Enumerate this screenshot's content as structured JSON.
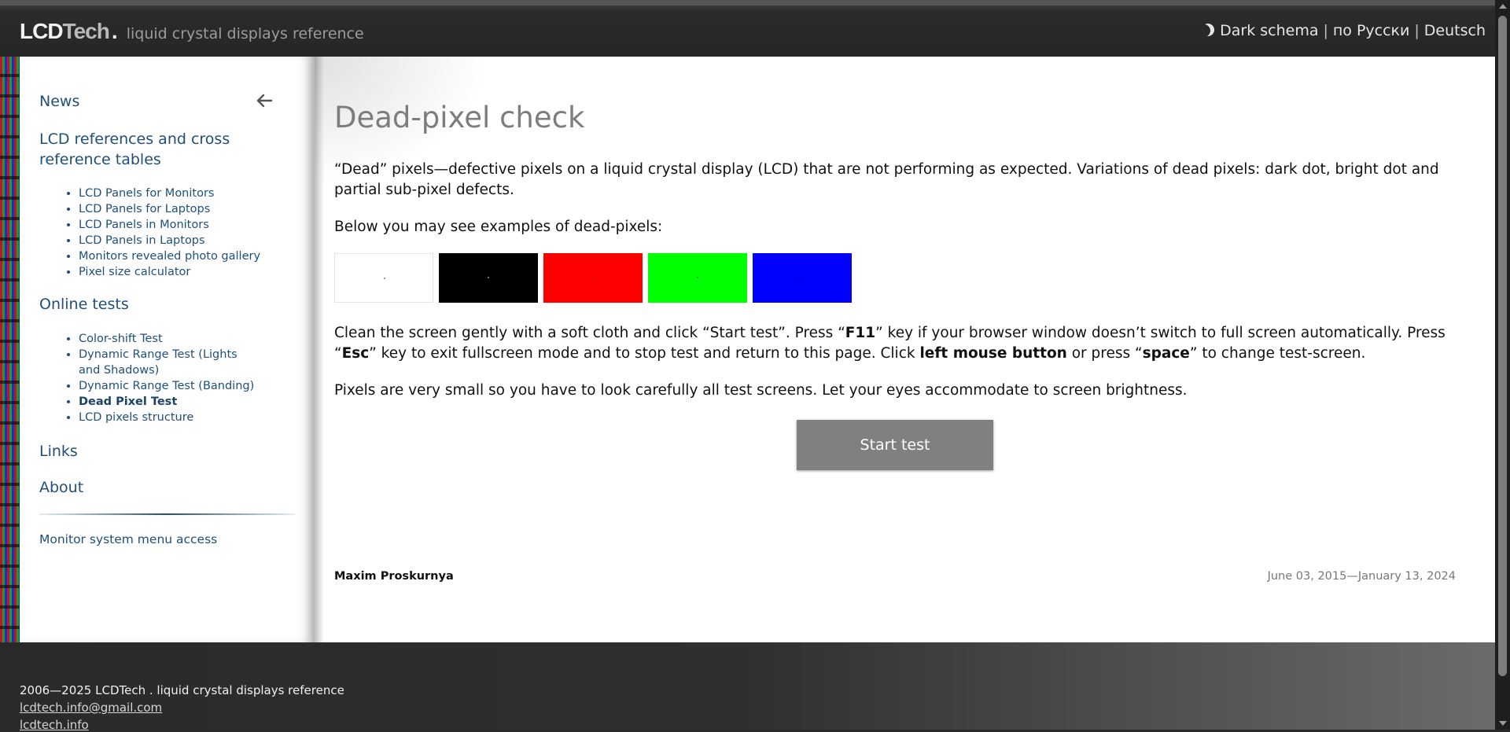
{
  "header": {
    "logo_lcd": "LCD",
    "logo_tech": "Tech",
    "logo_dot": ".",
    "logo_subtitle": "liquid crystal displays reference",
    "nav": {
      "dark_schema": "Dark schema",
      "separator": "|",
      "russian": "по Русски",
      "german": "Deutsch"
    }
  },
  "sidebar": {
    "news": "News",
    "lcd_refs": "LCD references and cross reference tables",
    "lcd_refs_items": [
      "LCD Panels for Monitors",
      "LCD Panels for Laptops",
      "LCD Panels in Monitors",
      "LCD Panels in Laptops",
      "Monitors revealed photo gallery",
      "Pixel size calculator"
    ],
    "online_tests": "Online tests",
    "online_tests_items": [
      "Color-shift Test",
      "Dynamic Range Test (Lights and Shadows)",
      "Dynamic Range Test (Banding)",
      "Dead Pixel Test",
      "LCD pixels structure"
    ],
    "links": "Links",
    "about": "About",
    "monitor_menu": "Monitor system menu access"
  },
  "main": {
    "title": "Dead-pixel check",
    "intro": "“Dead” pixels—defective pixels on a liquid crystal display (LCD) that are not performing as expected. Variations of dead pixels: dark dot, bright dot and partial sub-pixel defects.",
    "examples_label": "Below you may see examples of dead-pixels:",
    "swatches": [
      {
        "bg": "#ffffff",
        "dot": "#999999"
      },
      {
        "bg": "#000000",
        "dot": "#777777"
      },
      {
        "bg": "#ff0000",
        "dot": "#cc0000"
      },
      {
        "bg": "#00ff00",
        "dot": "#00aa00"
      },
      {
        "bg": "#0000ff",
        "dot": "#0000cc"
      }
    ],
    "instr": {
      "p1": "Clean the screen gently with a soft cloth and click “Start test”. Press “",
      "k1": "F11",
      "p2": "” key if your browser window doesn’t switch to full screen automatically. Press “",
      "k2": "Esc",
      "p3": "” key to exit fullscreen mode and to stop test and return to this page. Click ",
      "k3": "left mouse button",
      "p4": " or press “",
      "k4": "space",
      "p5": "” to change test-screen."
    },
    "note": "Pixels are very small so you have to look carefully all test screens. Let your eyes accommodate to screen brightness.",
    "start_button": "Start test",
    "author": "Maxim Proskurnya",
    "dates": "June 03, 2015—January 13, 2024"
  },
  "footer": {
    "copyright": "2006—2025 LCDTech . liquid crystal displays reference",
    "email": "lcdtech.info@gmail.com",
    "site": "lcdtech.info"
  }
}
